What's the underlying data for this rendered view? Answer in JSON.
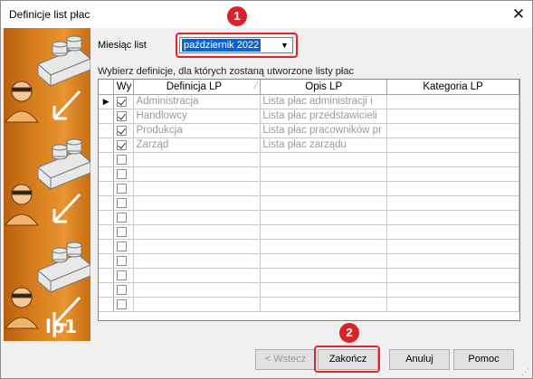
{
  "window": {
    "title": "Definicje list płac",
    "close_glyph": "✕"
  },
  "banner": {
    "label": "lp1"
  },
  "month": {
    "label": "Miesiąc list",
    "value": "październik 2022",
    "arrow": "▼"
  },
  "instruction": "Wybierz definicje, dla których zostaną utworzone listy płac",
  "grid": {
    "columns": [
      "Wy",
      "Definicja LP",
      "Opis LP",
      "Kategoria LP"
    ],
    "current_row_marker": "▶",
    "rows": [
      {
        "checked": true,
        "definicja": "Administracja",
        "opis": "Lista płac administracji i",
        "kategoria": ""
      },
      {
        "checked": true,
        "definicja": "Handlowcy",
        "opis": "Lista płac przedstawicieli",
        "kategoria": ""
      },
      {
        "checked": true,
        "definicja": "Produkcja",
        "opis": "Lista płac pracowników pr",
        "kategoria": ""
      },
      {
        "checked": true,
        "definicja": "Zarząd",
        "opis": "Lista płac zarządu",
        "kategoria": ""
      },
      {
        "checked": false,
        "definicja": "",
        "opis": "",
        "kategoria": ""
      },
      {
        "checked": false,
        "definicja": "",
        "opis": "",
        "kategoria": ""
      },
      {
        "checked": false,
        "definicja": "",
        "opis": "",
        "kategoria": ""
      },
      {
        "checked": false,
        "definicja": "",
        "opis": "",
        "kategoria": ""
      },
      {
        "checked": false,
        "definicja": "",
        "opis": "",
        "kategoria": ""
      },
      {
        "checked": false,
        "definicja": "",
        "opis": "",
        "kategoria": ""
      },
      {
        "checked": false,
        "definicja": "",
        "opis": "",
        "kategoria": ""
      },
      {
        "checked": false,
        "definicja": "",
        "opis": "",
        "kategoria": ""
      },
      {
        "checked": false,
        "definicja": "",
        "opis": "",
        "kategoria": ""
      },
      {
        "checked": false,
        "definicja": "",
        "opis": "",
        "kategoria": ""
      },
      {
        "checked": false,
        "definicja": "",
        "opis": "",
        "kategoria": ""
      }
    ]
  },
  "buttons": {
    "back": "< Wstecz",
    "finish": "Zakończ",
    "cancel": "Anuluj",
    "help": "Pomoc"
  },
  "annotations": {
    "step1": "1",
    "step2": "2"
  },
  "colors": {
    "highlight_red": "#e0242a",
    "selection_blue": "#0a63d0",
    "banner_orange": "#d9821f"
  }
}
